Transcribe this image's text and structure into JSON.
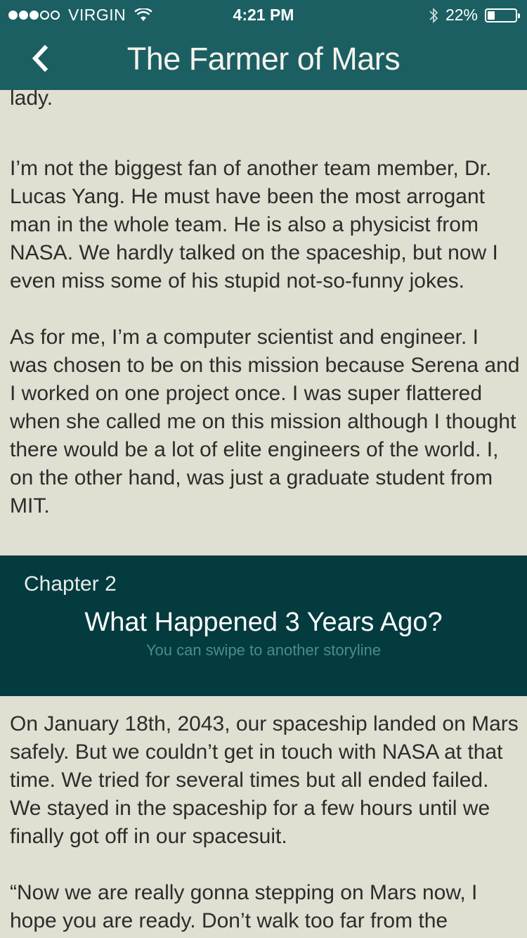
{
  "status_bar": {
    "carrier": "VIRGIN",
    "time": "4:21 PM",
    "battery": "22%",
    "signal_icon": "signal-dots-icon",
    "wifi_icon": "wifi-icon",
    "bluetooth_icon": "bluetooth-icon",
    "battery_icon": "battery-icon"
  },
  "nav": {
    "back_icon": "chevron-left-icon",
    "title": "The Farmer of Mars"
  },
  "story": {
    "partial_top": "good care of the samples we brought, such as sweet lady.",
    "paragraphs": [
      "I’m not the biggest fan of another team member, Dr. Lucas Yang. He must have been the most arrogant man in the whole team. He is also a physicist from NASA. We hardly talked on the spaceship, but now I even miss some of his stupid not-so-funny jokes.",
      "As for me, I’m a computer scientist and engineer. I was chosen to be on this mission because Serena and I worked on one project once. I was super flattered when she called me on this mission although I thought there would be a lot of elite engineers of the world. I, on the other hand, was just a graduate student from MIT."
    ]
  },
  "chapter": {
    "number": "Chapter 2",
    "title": "What Happened 3 Years Ago?",
    "hint": "You can swipe to another storyline"
  },
  "chapter_text": {
    "paragraphs": [
      "On January 18th, 2043, our spaceship landed on Mars safely. But we couldn’t get in touch with NASA at that time. We tried for several times but all ended failed. We stayed in the spaceship for a few hours until we finally got off in our spacesuit.",
      "“Now we are really gonna stepping on Mars now, I hope you are ready. Don’t walk too far from the"
    ]
  },
  "colors": {
    "nav_bg": "#1b5f63",
    "page_bg": "#e1dfd1",
    "chapter_bg": "#033b3f",
    "hint_text": "#4f8a8c"
  }
}
